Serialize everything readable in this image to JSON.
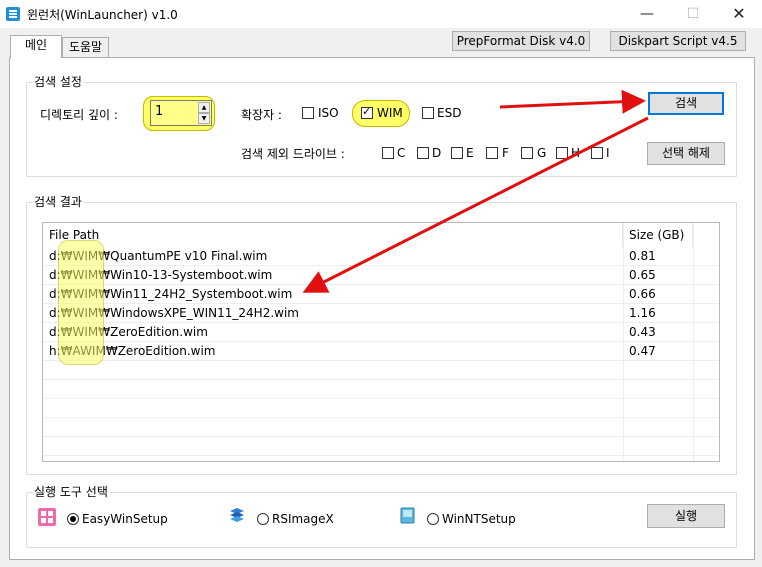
{
  "window": {
    "title": "윈런처(WinLauncher) v1.0",
    "min": "—",
    "max": "☐",
    "close": "✕"
  },
  "tabs": [
    "메인",
    "도움말"
  ],
  "top_buttons": {
    "prepformat": "PrepFormat Disk v4.0",
    "diskpart": "Diskpart Script v4.5"
  },
  "search_settings": {
    "title": "검색 설정",
    "depth_label": "디렉토리 깊이 :",
    "depth_value": "1",
    "ext_label": "확장자 :",
    "extensions": [
      {
        "label": "ISO",
        "checked": false
      },
      {
        "label": "WIM",
        "checked": true
      },
      {
        "label": "ESD",
        "checked": false
      }
    ],
    "exclude_label": "검색 제외 드라이브 :",
    "drives": [
      "C",
      "D",
      "E",
      "F",
      "G",
      "H",
      "I"
    ],
    "search_button": "검색",
    "deselect_button": "선택 해제"
  },
  "results": {
    "title": "검색 결과",
    "columns": [
      "File Path",
      "Size (GB)"
    ],
    "rows": [
      {
        "path": "d:₩WIM₩QuantumPE v10 Final.wim",
        "size": "0.81"
      },
      {
        "path": "d:₩WIM₩Win10-13-Systemboot.wim",
        "size": "0.65"
      },
      {
        "path": "d:₩WIM₩Win11_24H2_Systemboot.wim",
        "size": "0.66"
      },
      {
        "path": "d:₩WIM₩WindowsXPE_WIN11_24H2.wim",
        "size": "1.16"
      },
      {
        "path": "d:₩WIM₩ZeroEdition.wim",
        "size": "0.43"
      },
      {
        "path": "h:₩AWIM₩ZeroEdition.wim",
        "size": "0.47"
      }
    ]
  },
  "run_tools": {
    "title": "실행 도구 선택",
    "options": [
      {
        "label": "EasyWinSetup",
        "checked": true
      },
      {
        "label": "RSImageX",
        "checked": false
      },
      {
        "label": "WinNTSetup",
        "checked": false
      }
    ],
    "run_button": "실행"
  },
  "colors": {
    "highlight": "#ffff66",
    "arrow": "#e01010",
    "accent": "#0078d7"
  }
}
